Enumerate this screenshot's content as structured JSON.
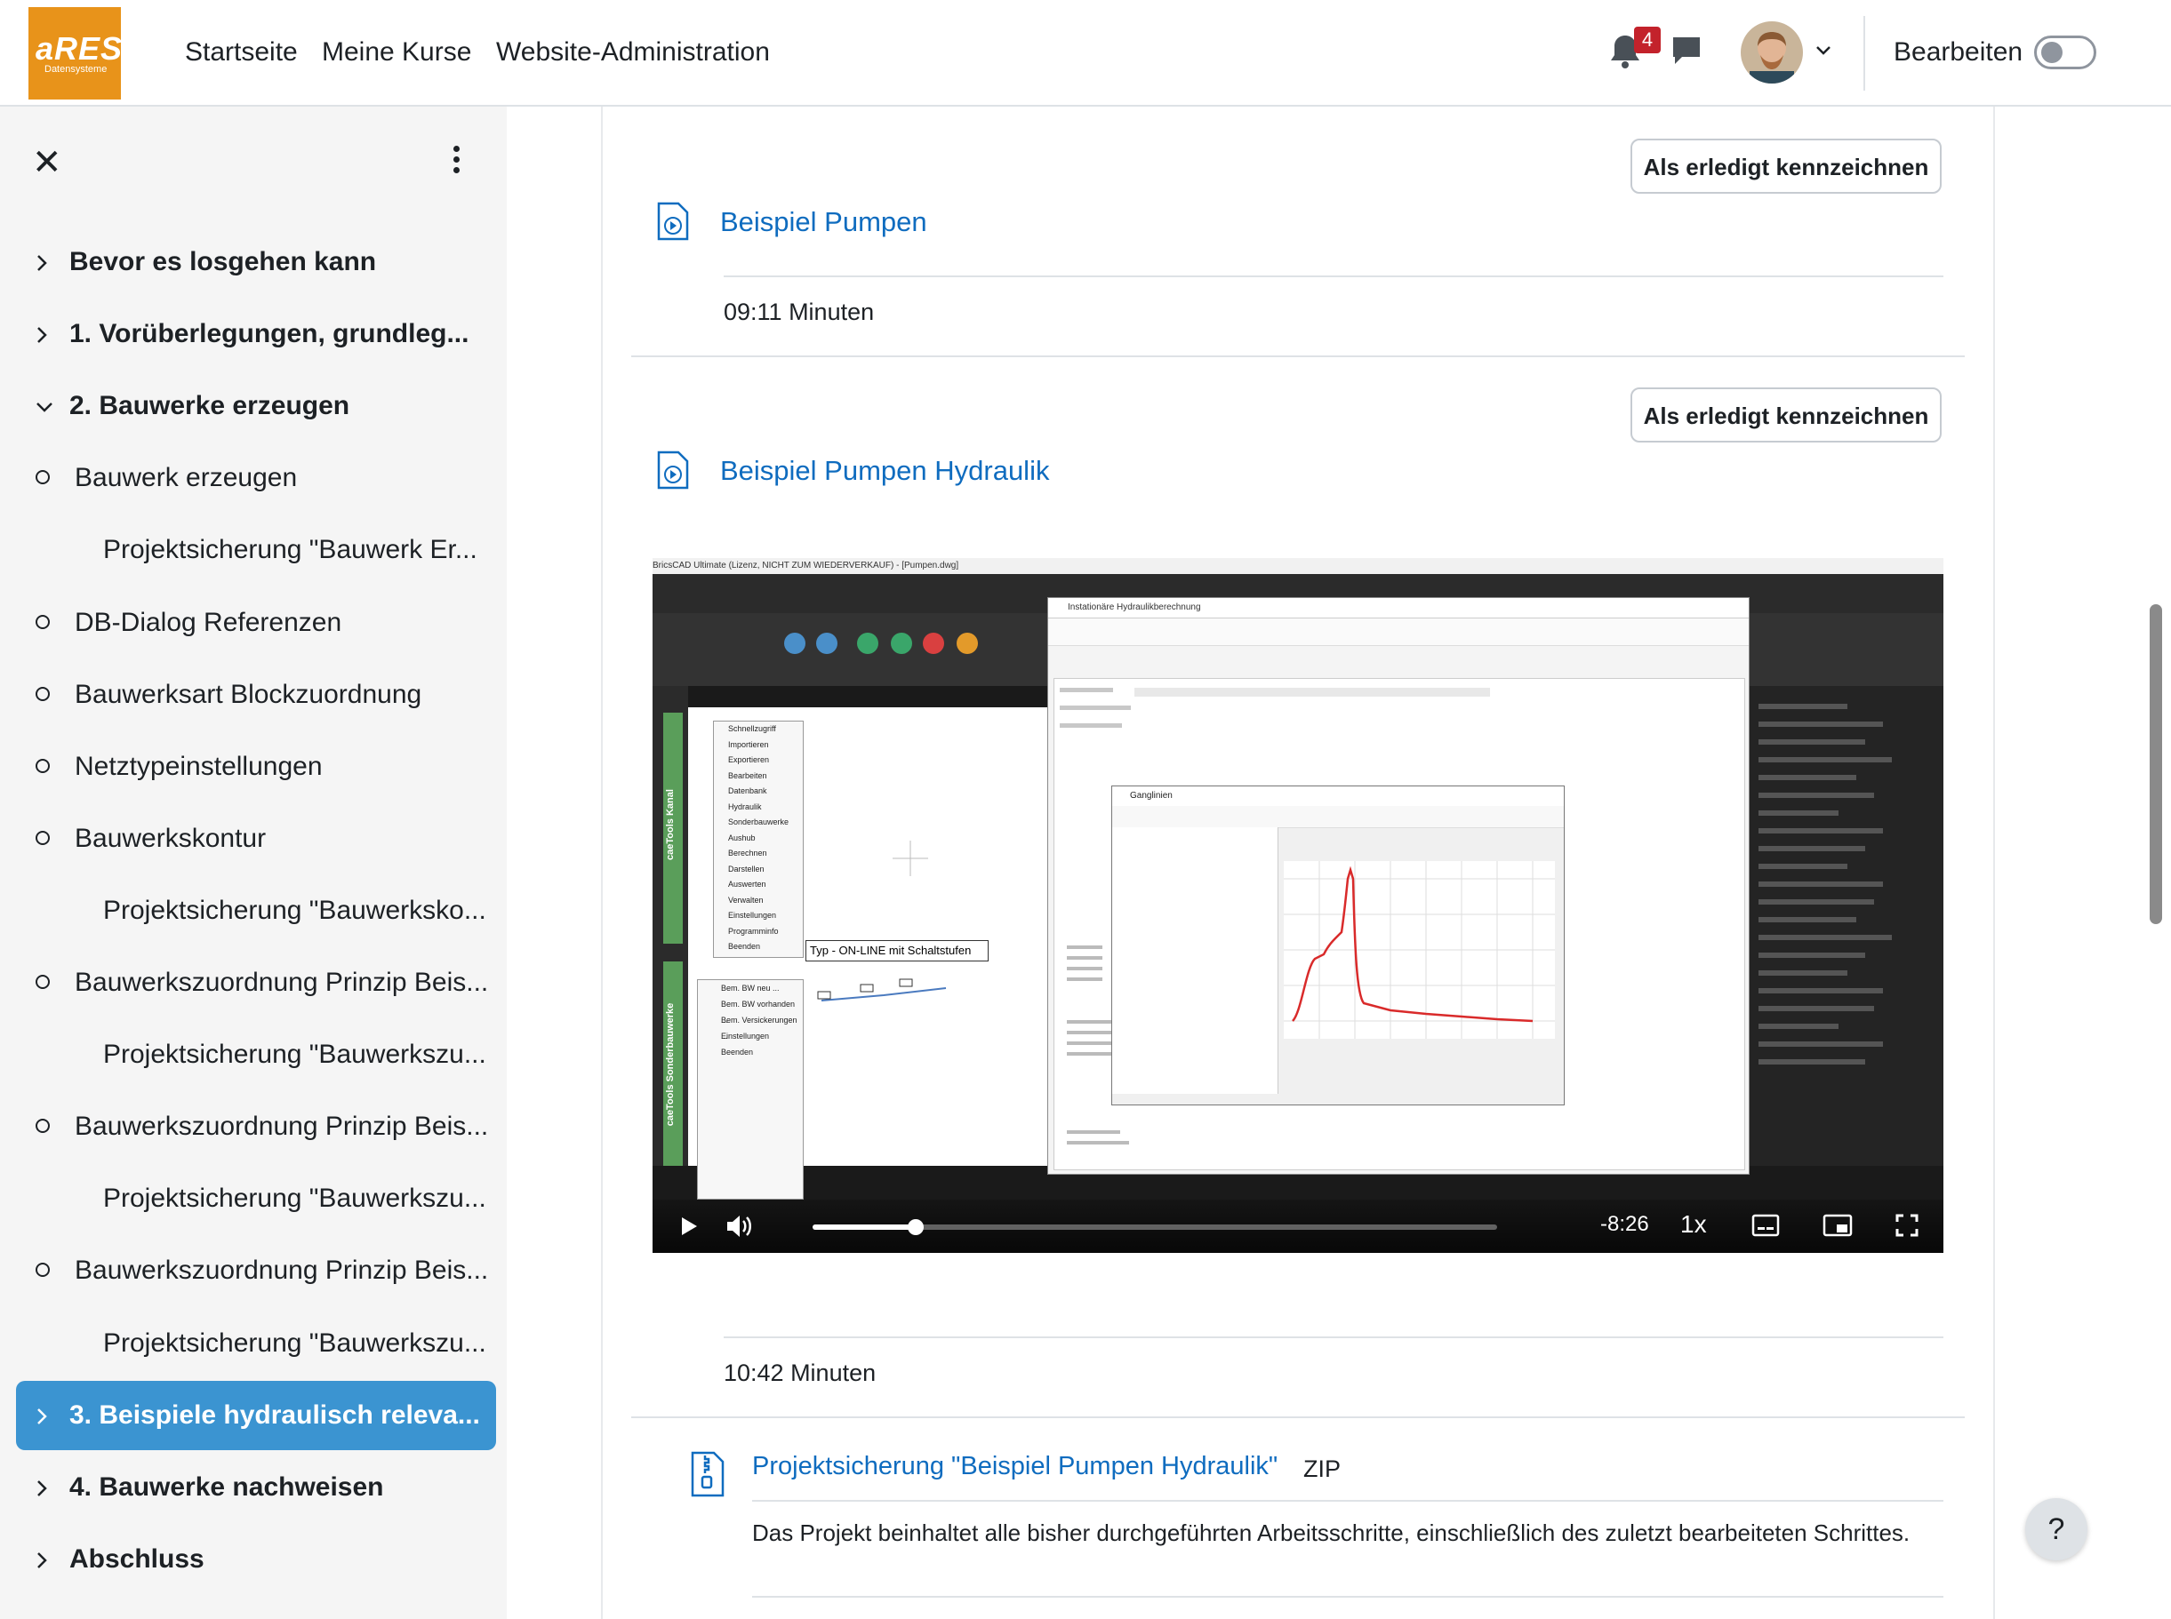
{
  "navbar": {
    "logo_text": "aRES",
    "logo_subtext": "Datensysteme",
    "links": [
      "Startseite",
      "Meine Kurse",
      "Website-Administration"
    ],
    "notification_count": "4",
    "edit_label": "Bearbeiten",
    "edit_mode_on": false
  },
  "drawer": {
    "items": [
      {
        "label": "Bevor es losgehen kann",
        "kind": "section"
      },
      {
        "label": "1. Vorüberlegungen, grundleg...",
        "kind": "section"
      },
      {
        "label": "2. Bauwerke erzeugen",
        "kind": "section",
        "expanded": true
      },
      {
        "label": "Bauwerk erzeugen",
        "kind": "activity"
      },
      {
        "label": "Projektsicherung \"Bauwerk Er...",
        "kind": "subitem"
      },
      {
        "label": "DB-Dialog Referenzen",
        "kind": "activity"
      },
      {
        "label": "Bauwerksart Blockzuordnung",
        "kind": "activity"
      },
      {
        "label": "Netztypeinstellungen",
        "kind": "activity"
      },
      {
        "label": "Bauwerkskontur",
        "kind": "activity"
      },
      {
        "label": "Projektsicherung \"Bauwerksko...",
        "kind": "subitem"
      },
      {
        "label": "Bauwerkszuordnung Prinzip Beis...",
        "kind": "activity"
      },
      {
        "label": "Projektsicherung \"Bauwerkszu...",
        "kind": "subitem"
      },
      {
        "label": "Bauwerkszuordnung Prinzip Beis...",
        "kind": "activity"
      },
      {
        "label": "Projektsicherung \"Bauwerkszu...",
        "kind": "subitem"
      },
      {
        "label": "Bauwerkszuordnung Prinzip Beis...",
        "kind": "activity"
      },
      {
        "label": "Projektsicherung \"Bauwerkszu...",
        "kind": "subitem"
      },
      {
        "label": "3. Beispiele hydraulisch releva...",
        "kind": "section",
        "current": true
      },
      {
        "label": "4. Bauwerke nachweisen",
        "kind": "section"
      },
      {
        "label": "Abschluss",
        "kind": "section"
      }
    ]
  },
  "main": {
    "activity1": {
      "button": "Als erledigt kennzeichnen",
      "title": "Beispiel Pumpen",
      "duration": "09:11 Minuten"
    },
    "activity2": {
      "button": "Als erledigt kennzeichnen",
      "title": "Beispiel Pumpen Hydraulik",
      "duration": "10:42 Minuten",
      "video": {
        "time_remaining": "-8:26",
        "speed": "1x",
        "progress": 0.15,
        "screenshot_window_title": "BricsCAD Ultimate (Lizenz, NICHT ZUM WIEDERVERKAUF) - [Pumpen.dwg]",
        "screenshot_dialog_title": "Instationäre Hydraulikberechnung",
        "screenshot_graph_title": "Ganglinien",
        "screenshot_label": "Typ - ON-LINE mit Schaltstufen",
        "screenshot_context_menu": [
          "Schnellzugriff",
          "Importieren",
          "Exportieren",
          "Bearbeiten",
          "Datenbank",
          "Hydraulik",
          "Sonderbauwerke",
          "Aushub",
          "Berechnen",
          "Darstellen",
          "Auswerten",
          "Verwalten",
          "Einstellungen",
          "Programminfo",
          "Beenden"
        ],
        "screenshot_context_menu2": [
          "Bem. BW neu ...",
          "Bem. BW vorhanden ...",
          "Bem. Versickerungen ...",
          "Einstellungen",
          "Beenden"
        ],
        "screenshot_sidebar_label1": "caeTools Kanal",
        "screenshot_sidebar_label2": "caeTools Sonderbauwerke"
      }
    },
    "resource": {
      "title": "Projektsicherung \"Beispiel Pumpen Hydraulik\"",
      "type": "ZIP",
      "description": "Das Projekt beinhaltet alle bisher durchgeführten Arbeitsschritte, einschließlich des zuletzt bearbeiteten Schrittes."
    },
    "help_label": "?"
  },
  "colors": {
    "brand_orange": "#e8931a",
    "link_blue": "#0f6cbf",
    "current_section": "#3b94d1",
    "badge_red": "#c3222b",
    "drawer_bg": "#f5f5f5"
  }
}
